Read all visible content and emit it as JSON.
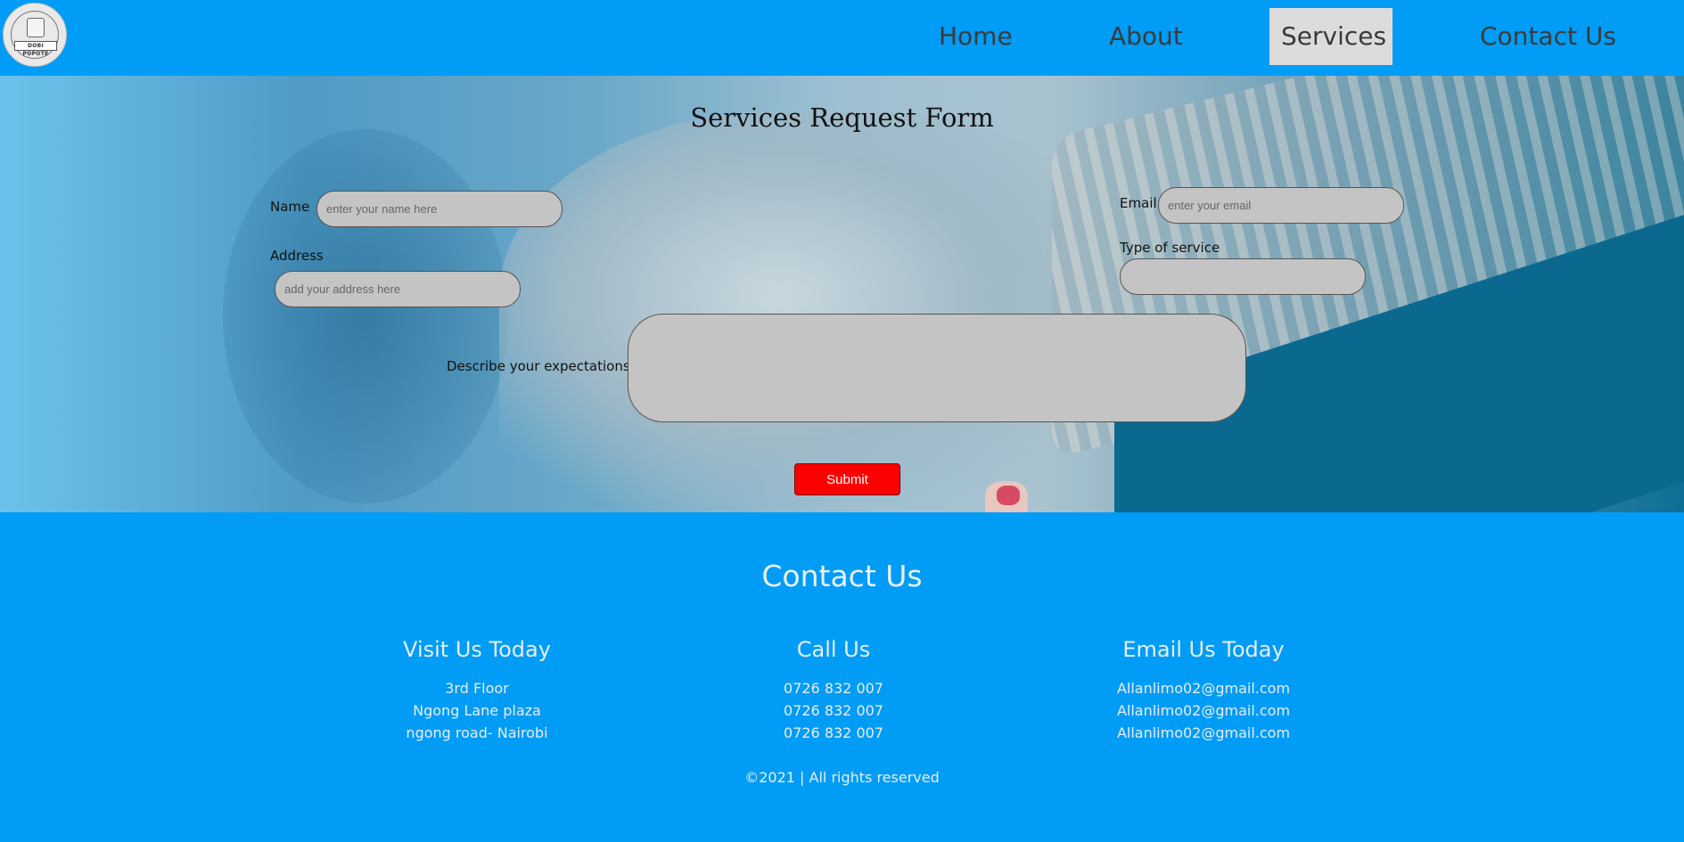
{
  "nav": {
    "logo_text": "DOBI POPOTE",
    "links": [
      "Home",
      "About",
      "Services",
      "Contact Us"
    ],
    "active": "Services"
  },
  "form": {
    "title": "Services Request Form",
    "name_label": "Name",
    "name_placeholder": "enter your name here",
    "address_label": "Address",
    "address_placeholder": "add your address here",
    "email_label": "Email",
    "email_placeholder": "enter your email",
    "service_label": "Type of service",
    "expectations_label": "Describe your expectations:",
    "submit_label": "Submit"
  },
  "footer": {
    "title": "Contact Us",
    "visit": {
      "title": "Visit Us Today",
      "lines": [
        "3rd Floor",
        "Ngong Lane plaza",
        "ngong road- Nairobi"
      ]
    },
    "call": {
      "title": "Call Us",
      "lines": [
        "0726 832 007",
        "0726 832 007",
        "0726 832 007"
      ]
    },
    "email": {
      "title": "Email Us Today",
      "lines": [
        "Allanlimo02@gmail.com",
        "Allanlimo02@gmail.com",
        "Allanlimo02@gmail.com"
      ]
    },
    "copyright": "©2021 | All rights reserved"
  },
  "colors": {
    "nav_bg": "#009cf5",
    "active_tab_bg": "#dcdcdc",
    "submit_bg": "#ff0000",
    "field_bg": "#c4c4c4"
  }
}
